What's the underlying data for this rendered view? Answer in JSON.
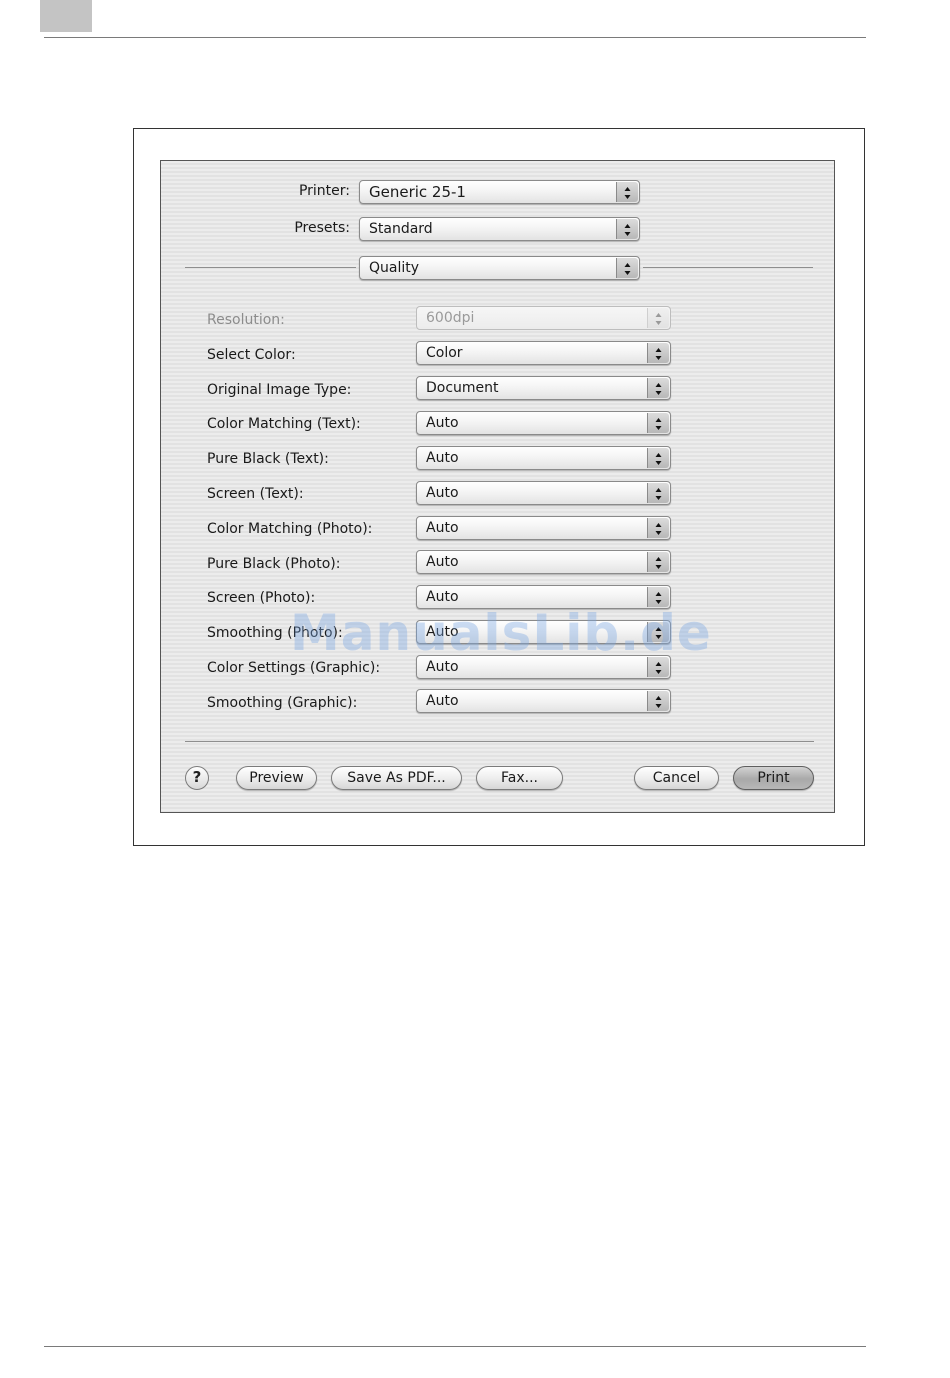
{
  "print_dialog": {
    "printer": {
      "label": "Printer:",
      "value": "Generic 25-1"
    },
    "presets": {
      "label": "Presets:",
      "value": "Standard"
    },
    "panel_select": {
      "value": "Quality"
    },
    "settings": [
      {
        "label": "Resolution:",
        "value": "600dpi",
        "disabled": true
      },
      {
        "label": "Select Color:",
        "value": "Color"
      },
      {
        "label": "Original Image Type:",
        "value": "Document"
      },
      {
        "label": "Color Matching (Text):",
        "value": "Auto"
      },
      {
        "label": "Pure Black (Text):",
        "value": "Auto"
      },
      {
        "label": "Screen (Text):",
        "value": "Auto"
      },
      {
        "label": "Color Matching (Photo):",
        "value": "Auto"
      },
      {
        "label": "Pure Black (Photo):",
        "value": "Auto"
      },
      {
        "label": "Screen (Photo):",
        "value": "Auto"
      },
      {
        "label": "Smoothing (Photo):",
        "value": "Auto"
      },
      {
        "label": "Color Settings (Graphic):",
        "value": "Auto"
      },
      {
        "label": "Smoothing (Graphic):",
        "value": "Auto"
      }
    ],
    "buttons": {
      "help": "?",
      "preview": "Preview",
      "save_as_pdf": "Save As PDF...",
      "fax": "Fax...",
      "cancel": "Cancel",
      "print": "Print"
    }
  },
  "watermark": "ManualsLib.de",
  "icons": {
    "popup_arrows": "up-down-arrows-icon"
  }
}
